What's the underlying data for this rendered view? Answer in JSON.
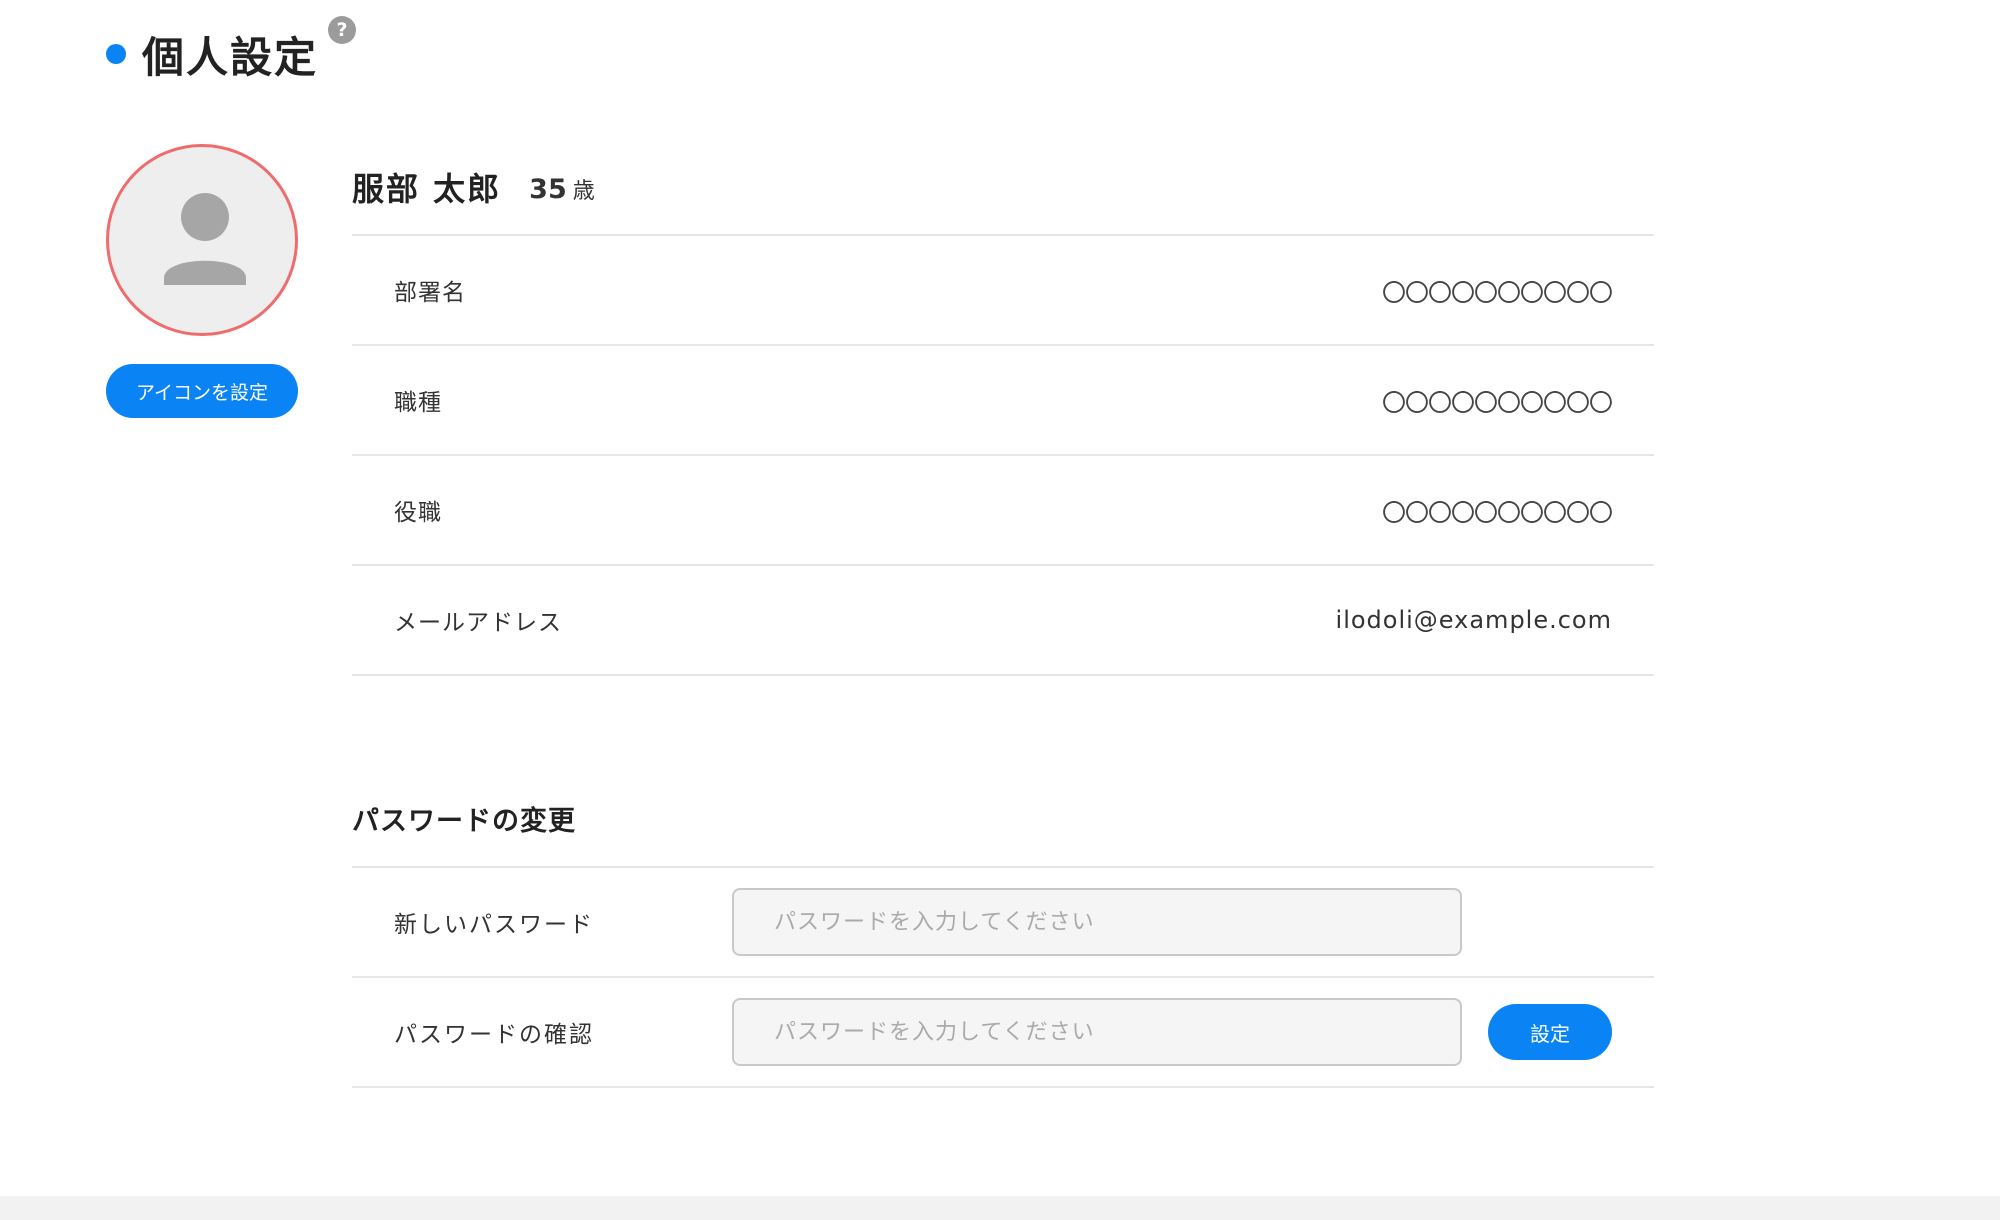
{
  "colors": {
    "accent": "#0a84f5",
    "avatar_border": "#f06b6b",
    "divider": "#e5e5e5"
  },
  "header": {
    "title": "個人設定",
    "help_icon": "question-circle-icon"
  },
  "avatar": {
    "icon": "user-silhouette-icon",
    "button_label": "アイコンを設定"
  },
  "profile": {
    "name": "服部 太郎",
    "age": "35",
    "age_unit": "歳",
    "fields": [
      {
        "label": "部署名",
        "value": "〇〇〇〇〇〇〇〇〇〇"
      },
      {
        "label": "職種",
        "value": "〇〇〇〇〇〇〇〇〇〇"
      },
      {
        "label": "役職",
        "value": "〇〇〇〇〇〇〇〇〇〇"
      },
      {
        "label": "メールアドレス",
        "value": "ilodoli@example.com"
      }
    ]
  },
  "password": {
    "section_title": "パスワードの変更",
    "new_label": "新しいパスワード",
    "new_placeholder": "パスワードを入力してください",
    "confirm_label": "パスワードの確認",
    "confirm_placeholder": "パスワードを入力してください",
    "submit_label": "設定"
  }
}
